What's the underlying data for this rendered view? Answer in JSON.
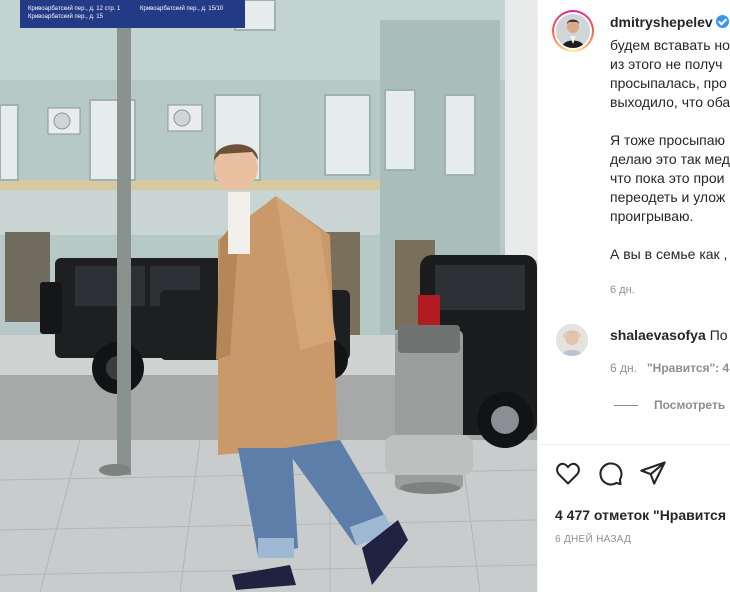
{
  "post": {
    "username": "dmitryshepelev",
    "caption_lines": [
      "будем вставать но",
      "из этого не получ",
      "просыпалась, про",
      "выходило, что оба",
      "",
      "Я тоже просыпаю",
      "делаю это так мед",
      "что пока это прои",
      "переодеть и улож",
      "проигрываю.",
      "",
      "А вы в семье как ,"
    ],
    "time": "6 дн."
  },
  "comment": {
    "username": "shalaevasofya",
    "text": "По",
    "time": "6 дн.",
    "likes_text": "\"Нравится\": 4"
  },
  "view_replies": "Посмотреть",
  "actions": {
    "like_icon": "heart-icon",
    "comment_icon": "comment-bubble-icon",
    "share_icon": "paper-plane-icon"
  },
  "likes_count": "4 477 отметок \"Нравится",
  "post_date": "6 ДНЕЙ НАЗАД",
  "photo": {
    "street_sign_line1": "Кривоарбатский пер., д. 12 стр. 1",
    "street_sign_line2": "Кривоарбатский пер., д. 15",
    "street_sign_line3": "Кривоарбатский пер., д. 15/10"
  },
  "colors": {
    "accent": "#3897f0",
    "muted": "#8e8e8e",
    "text": "#262626",
    "coat": "#c9996a"
  }
}
